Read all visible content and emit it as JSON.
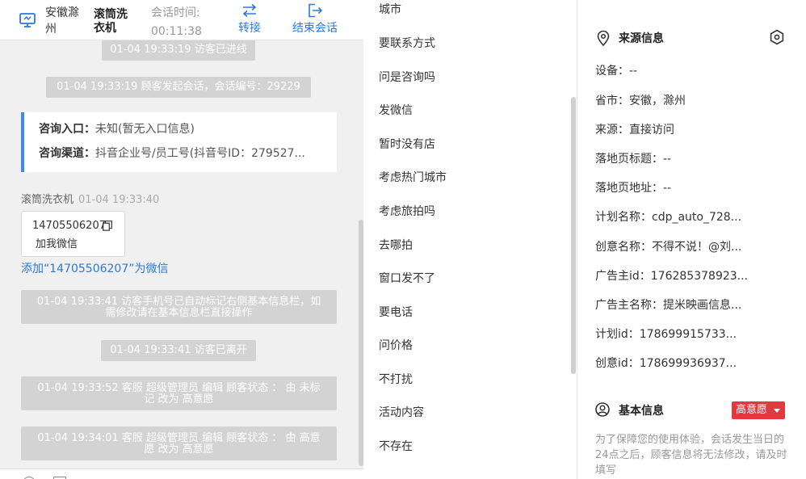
{
  "header": {
    "location": "安徽滁州",
    "visitor_name": "滚筒洗衣机",
    "session_time_label": "会话时间:",
    "session_time_value": "00:11:38",
    "transfer_label": "转接",
    "end_session_label": "结束会话"
  },
  "chat": {
    "messages": [
      "01-04 19:33:19 访客已进线",
      "01-04 19:33:19 顾客发起会话，会话编号：29229",
      "01-04 19:33:41 访客手机号已自动标记右侧基本信息栏，如需修改请在基本信息栏直接操作",
      "01-04 19:33:41 访客已离开",
      "01-04 19:33:52 客服 超级管理员 编辑 顾客状态 ： 由 未标记 改为 高意愿",
      "01-04 19:34:01 客服 超级管理员 编辑 顾客状态 ： 由 高意愿 改为 高意愿"
    ],
    "entry_label": "咨询入口：",
    "entry_value": "未知(暂无入口信息)",
    "channel_label": "咨询渠道：",
    "channel_value": "抖音企业号/员工号(抖音号ID：279527...",
    "sender": "滚筒洗衣机",
    "sender_time": "01-04 19:33:40",
    "wechat_number": "14705506207",
    "wechat_add_label": "加我微信",
    "add_wechat_link": "添加“14705506207”为微信"
  },
  "quick_replies": [
    "城市",
    "要联系方式",
    "问是咨询吗",
    "发微信",
    "暂时没有店",
    "考虑热门城市",
    "考虑旅拍吗",
    "去哪拍",
    "窗口发不了",
    "要电话",
    "问价格",
    "不打扰",
    "活动内容",
    "不存在"
  ],
  "source_info": {
    "title": "来源信息",
    "rows": [
      "设备：--",
      "省市：安徽，滁州",
      "来源：直接访问",
      "落地页标题：--",
      "落地页地址：--",
      "计划名称：cdp_auto_728...",
      "创意名称：不得不说！@刘...",
      "广告主id：176285378923...",
      "广告主名称：提米映画信息...",
      "计划id：178699915733...",
      "创意id：178699936937..."
    ]
  },
  "basic_info": {
    "title": "基本信息",
    "intent_badge": "高意愿",
    "notice": "为了保障您的使用体验，会话发生当日的24点之后，顾客信息将无法修改，请及时填写"
  },
  "colors": {
    "accent": "#2d7ad6",
    "badge": "#e0393e",
    "system_message": "#d3d3d3"
  }
}
